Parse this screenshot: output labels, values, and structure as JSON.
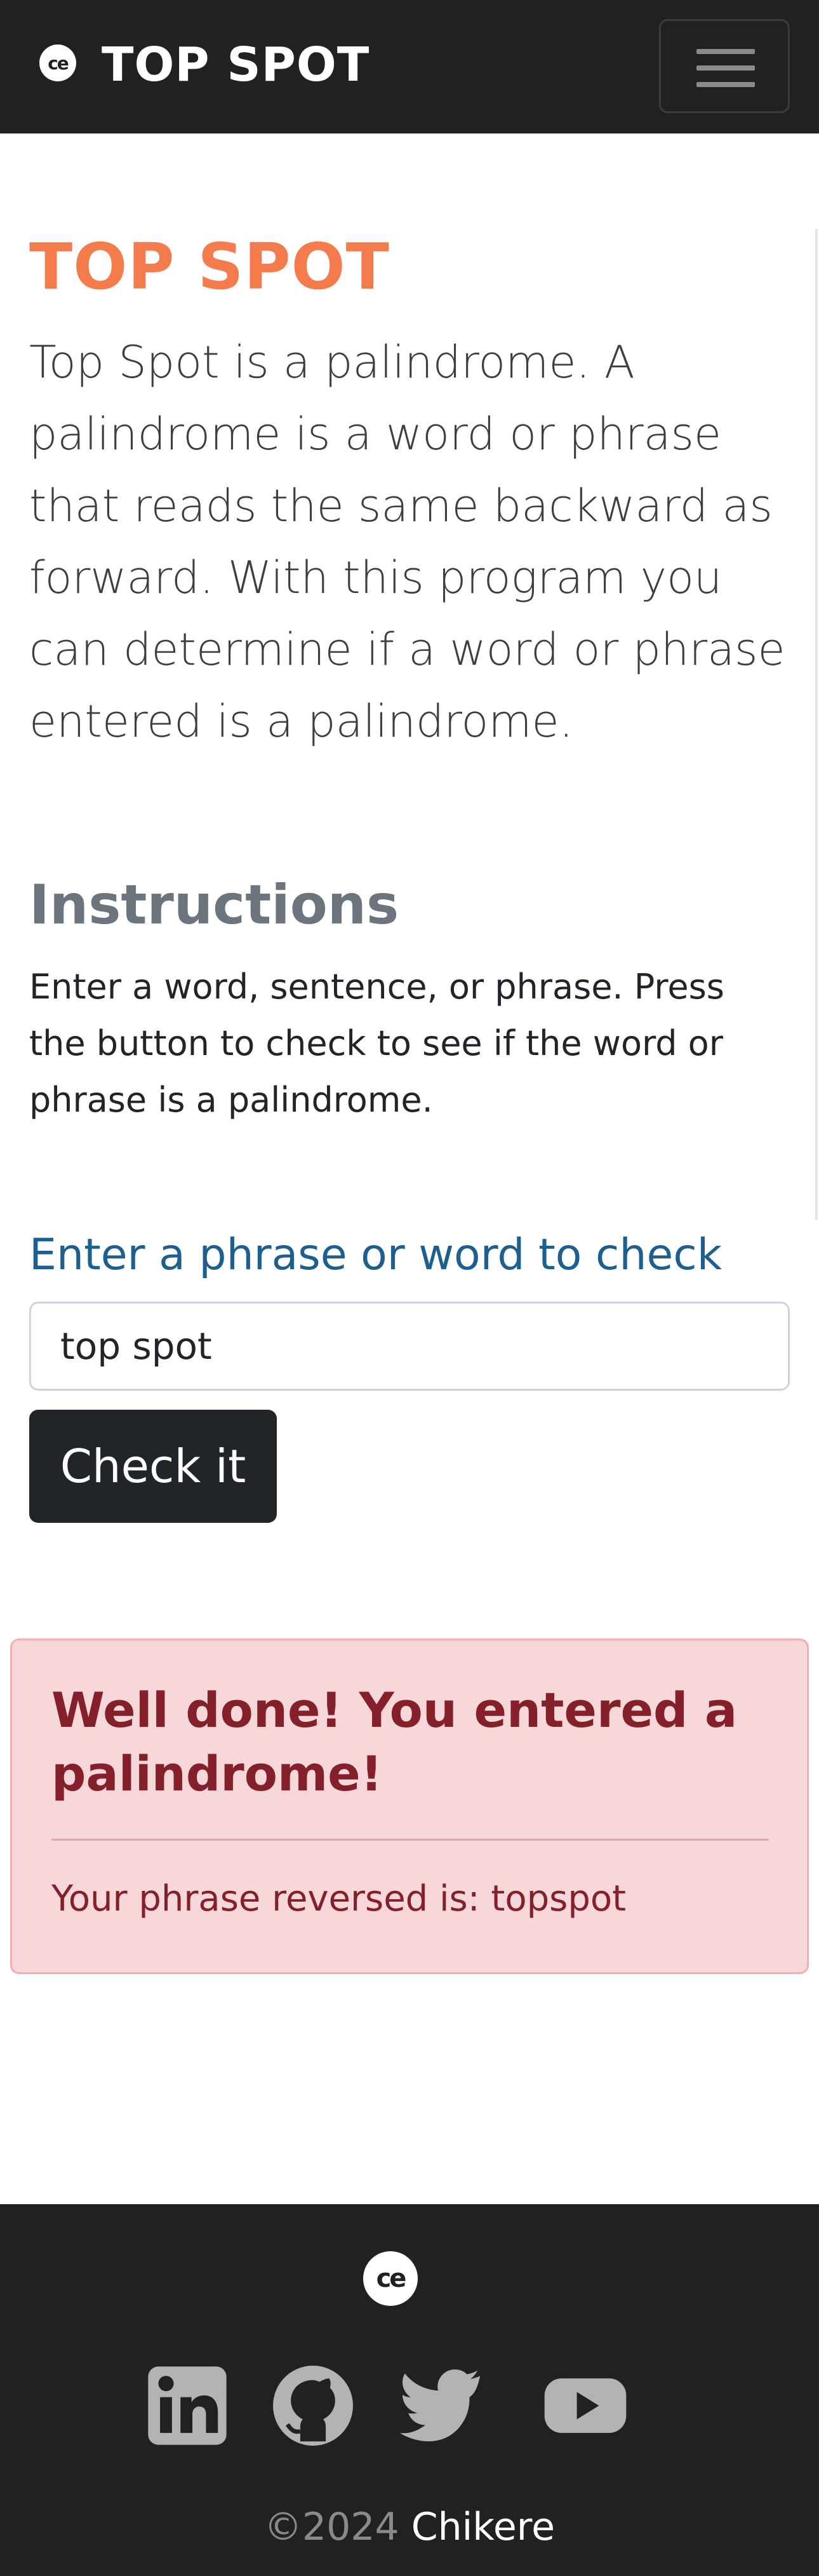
{
  "navbar": {
    "logo_text": "ce",
    "brand": "TOP SPOT"
  },
  "main": {
    "title": "TOP SPOT",
    "intro": "Top Spot is a palindrome. A palindrome is a word or phrase that reads the same backward as forward. With this program you can determine if a word or phrase entered is a palindrome.",
    "instructions_title": "Instructions",
    "instructions_text": "Enter a word, sentence, or phrase. Press the button to check to see if the word or phrase is a palindrome.",
    "form_label": "Enter a phrase or word to check",
    "input_value": "top spot",
    "button_label": "Check it"
  },
  "alert": {
    "heading": "Well done! You entered a palindrome!",
    "text": "Your phrase reversed is: topspot"
  },
  "footer": {
    "logo_text": "ce",
    "social": [
      "linkedin-icon",
      "github-icon",
      "twitter-icon",
      "youtube-icon"
    ],
    "copyright_symbol_year": "©2024",
    "copyright_name": "Chikere"
  },
  "colors": {
    "navbar_bg": "#212121",
    "title": "#f47b4b",
    "label": "#1d5f8f",
    "alert_bg": "#f8d7da",
    "alert_text": "#842029",
    "button_bg": "#212529",
    "social_icon": "#b3b3b3"
  }
}
